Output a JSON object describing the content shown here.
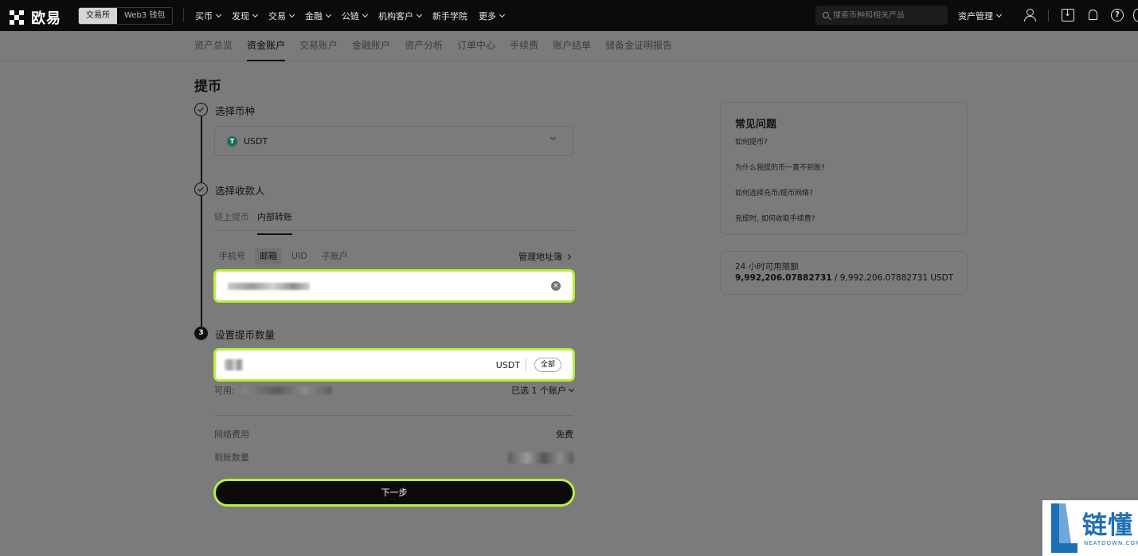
{
  "topbar": {
    "logo_text": "欧易",
    "modes": [
      "交易所",
      "Web3 钱包"
    ],
    "nav": [
      "买币",
      "发现",
      "交易",
      "金融",
      "公链",
      "机构客户",
      "新手学院",
      "更多"
    ],
    "nav_has_chevron": [
      true,
      true,
      true,
      true,
      true,
      true,
      false,
      true
    ],
    "search_placeholder": "搜索币种和相关产品",
    "asset_mgmt": "资产管理"
  },
  "subnav": {
    "tabs": [
      "资产总览",
      "资金账户",
      "交易账户",
      "金融账户",
      "资产分析",
      "订单中心",
      "手续费",
      "账户结单",
      "储备金证明报告"
    ],
    "active_index": 1
  },
  "page": {
    "title": "提币",
    "step1": {
      "label": "选择币种",
      "coin": "USDT",
      "coin_icon": "T"
    },
    "step2": {
      "label": "选择收款人",
      "tabs": [
        "链上提币",
        "内部转账"
      ],
      "active_tab": 1,
      "kinds": [
        "手机号",
        "邮箱",
        "UID",
        "子账户"
      ],
      "active_kind": 1,
      "address_book": "管理地址簿"
    },
    "step3": {
      "number": "3",
      "label": "设置提币数量",
      "unit": "USDT",
      "all_label": "全部",
      "available_label": "可用:",
      "account_select": "已选 1 个账户"
    },
    "fee_label": "网络费用",
    "fee_value": "免费",
    "receive_label": "到账数量",
    "next_button": "下一步"
  },
  "faq": {
    "title": "常见问题",
    "items": [
      "如何提币?",
      "为什么我提的币一直不到账?",
      "如何选择充币/提币网络?",
      "充提时, 如何收取手续费?"
    ]
  },
  "limit": {
    "label": "24 小时可用限额",
    "used": "9,992,206.07882731",
    "rest": " / 9,992,206.07882731 USDT"
  },
  "watermark": {
    "text": "链懂",
    "sub": "NEATDOWN.COM"
  },
  "colors": {
    "highlight": "#b7f03a",
    "watermark": "#1d6fb8",
    "overlay": "#7b7b7b"
  }
}
